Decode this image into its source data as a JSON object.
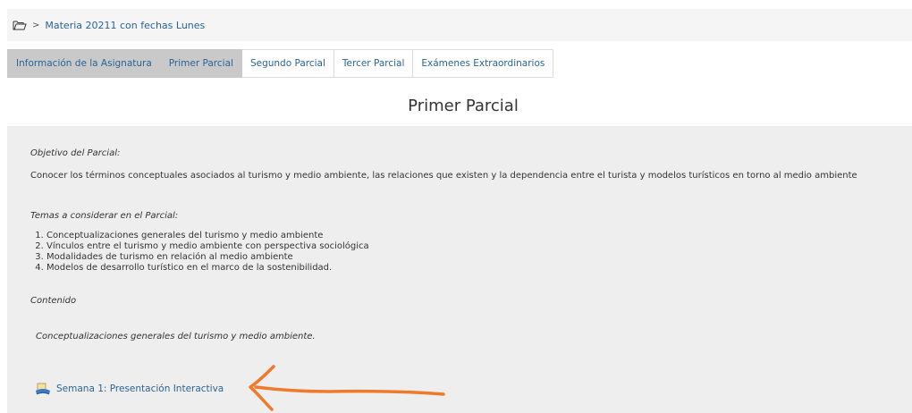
{
  "breadcrumb": {
    "icon": "folder-open-icon",
    "separator": ">",
    "course": "Materia 20211 con fechas Lunes"
  },
  "tabs": [
    {
      "label": "Información de la Asignatura",
      "state": "highlighted"
    },
    {
      "label": "Primer Parcial",
      "state": "active"
    },
    {
      "label": "Segundo Parcial",
      "state": "normal"
    },
    {
      "label": "Tercer Parcial",
      "state": "normal"
    },
    {
      "label": "Exámenes Extraordinarios",
      "state": "normal"
    }
  ],
  "section": {
    "title": "Primer Parcial",
    "objective_heading": "Objetivo del Parcial:",
    "objective_text": "Conocer los términos conceptuales asociados al turismo y medio ambiente, las relaciones que existen y la dependencia entre el turista y modelos turísticos en torno al medio ambiente",
    "topics_heading": "Temas a considerar en el Parcial:",
    "topics": [
      "Conceptualizaciones generales del turismo y medio ambiente",
      "Vínculos entre el turismo y medio ambiente con perspectiva sociológica",
      "Modalidades de turismo en relación al medio ambiente",
      "Modelos de desarrollo turístico en el marco de la sostenibilidad."
    ],
    "content_heading": "Contenido",
    "content_subtitle": "Conceptualizaciones generales del turismo y medio ambiente.",
    "resource": {
      "icon": "interactive-presentation-icon",
      "label": "Semana 1: Presentación Interactiva"
    }
  },
  "annotation": {
    "icon": "orange-arrow-icon",
    "color": "#f07a2c"
  },
  "colors": {
    "link": "#2a6496",
    "tab_gray": "#c9c9c9",
    "content_bg": "#eeeeee",
    "breadcrumb_bg": "#f5f5f5"
  }
}
